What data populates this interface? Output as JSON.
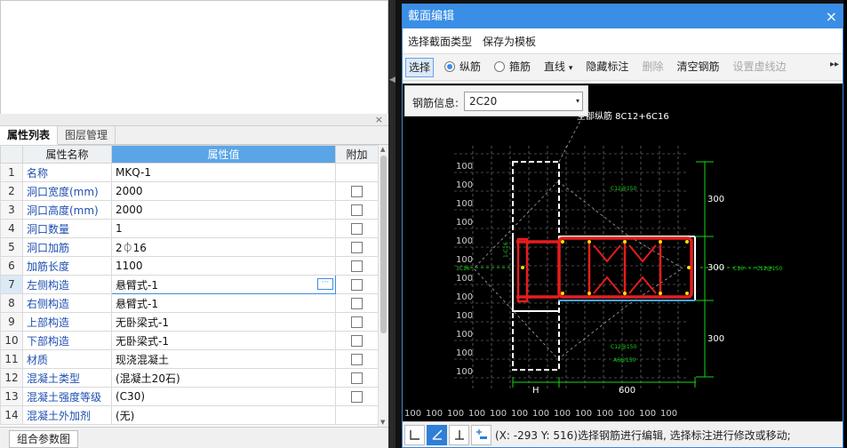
{
  "left_panel": {
    "close_glyph": "×",
    "tabs": [
      "属性列表",
      "图层管理"
    ],
    "table": {
      "headers": {
        "num": "",
        "name": "属性名称",
        "value": "属性值",
        "extra": "附加"
      },
      "rows": [
        {
          "num": "1",
          "name": "名称",
          "value": "MKQ-1",
          "has_check": false
        },
        {
          "num": "2",
          "name": "洞口宽度(mm)",
          "value": "2000",
          "has_check": true
        },
        {
          "num": "3",
          "name": "洞口高度(mm)",
          "value": "2000",
          "has_check": true
        },
        {
          "num": "4",
          "name": "洞口数量",
          "value": "1",
          "has_check": true
        },
        {
          "num": "5",
          "name": "洞口加筋",
          "value": "2⏀16",
          "has_check": true
        },
        {
          "num": "6",
          "name": "加筋长度",
          "value": "1100",
          "has_check": true
        },
        {
          "num": "7",
          "name": "左侧构造",
          "value": "悬臂式-1",
          "has_check": true,
          "selected": true
        },
        {
          "num": "8",
          "name": "右侧构造",
          "value": "悬臂式-1",
          "has_check": true
        },
        {
          "num": "9",
          "name": "上部构造",
          "value": "无卧梁式-1",
          "has_check": true
        },
        {
          "num": "10",
          "name": "下部构造",
          "value": "无卧梁式-1",
          "has_check": true
        },
        {
          "num": "11",
          "name": "材质",
          "value": "现浇混凝土",
          "has_check": true
        },
        {
          "num": "12",
          "name": "混凝土类型",
          "value": "(混凝土20石)",
          "has_check": true
        },
        {
          "num": "13",
          "name": "混凝土强度等级",
          "value": "(C30)",
          "has_check": true
        },
        {
          "num": "14",
          "name": "混凝土外加剂",
          "value": "(无)",
          "has_check": false
        }
      ],
      "ellipsis_glyph": "···"
    },
    "bottom_button": "组合参数图"
  },
  "dialog": {
    "title": "截面编辑",
    "close_glyph": "×",
    "menu": [
      "选择截面类型",
      "保存为模板"
    ],
    "toolbar": {
      "select": "选择",
      "radio_long": "纵筋",
      "radio_stirrup": "箍筋",
      "line": "直线",
      "line_arrow": "▾",
      "hide_label": "隐藏标注",
      "delete": "删除",
      "clear_rebar": "清空钢筋",
      "set_dashed": "设置虚线边",
      "more_glyph": "▸▸"
    },
    "rebar_info": {
      "label": "钢筋信息:",
      "value": "2C20",
      "arrow": "▾"
    },
    "canvas": {
      "annotation_all": "全部纵筋 8C12+6C16",
      "dim_top": "300",
      "dim_mid": "300",
      "dim_bottom": "300",
      "dim_width": "600",
      "label_h": "H",
      "stirrup_top": "C12@150",
      "stirrup_bottom1": "C12@150",
      "stirrup_bottom2": "A6@150",
      "right_label": "C16 - - - C12@150",
      "left_label": "3C16",
      "left_vertical": "1-C16",
      "grid_labels": [
        "100",
        "100",
        "100",
        "100",
        "100",
        "100",
        "100",
        "100",
        "100",
        "100",
        "100",
        "100",
        "100"
      ],
      "side_labels": [
        "100",
        "100",
        "100",
        "100",
        "100",
        "100",
        "100",
        "100",
        "100",
        "100",
        "100",
        "100"
      ]
    },
    "status": "(X: -293 Y: 516)选择钢筋进行编辑, 选择标注进行修改或移动;"
  },
  "colors": {
    "accent": "#3a8ee6",
    "rebar": "#e81c1c",
    "dimension": "#19d419",
    "grid": "#9a9a9a"
  }
}
